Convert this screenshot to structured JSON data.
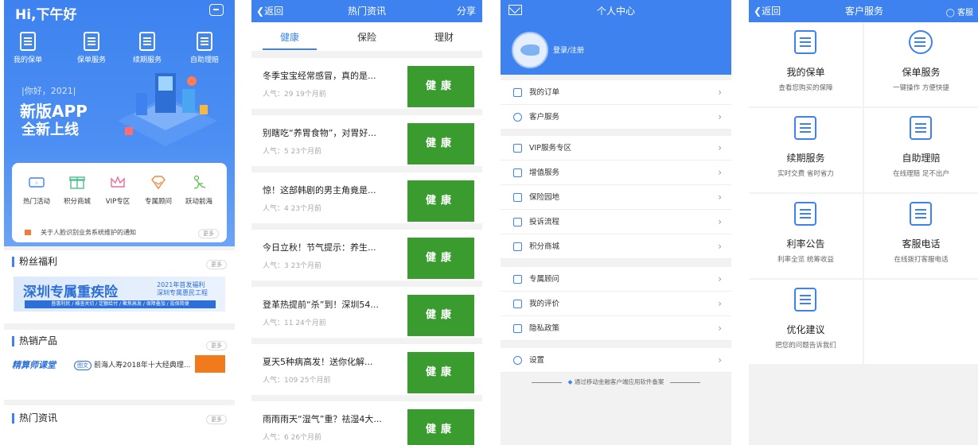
{
  "colors": {
    "brand_blue": "#3d82ef",
    "tag_green": "#3a9b2e",
    "accent_orange": "#f07a1c"
  },
  "phone1": {
    "greeting": "Hi,下午好",
    "quick_actions": [
      {
        "label": "我的保单",
        "icon": "policy-doc-icon"
      },
      {
        "label": "保单服务",
        "icon": "service-doc-icon"
      },
      {
        "label": "续期服务",
        "icon": "renewal-icon"
      },
      {
        "label": "自助理赔",
        "icon": "claim-icon"
      }
    ],
    "banner": {
      "year_line": "|你好，2021|",
      "line1": "新版APP",
      "line2": "全新上线"
    },
    "promos": [
      {
        "label": "热门活动",
        "icon": "ticket-icon"
      },
      {
        "label": "积分商城",
        "icon": "gift-icon"
      },
      {
        "label": "VIP专区",
        "icon": "crown-icon"
      },
      {
        "label": "专属顾问",
        "icon": "diamond-icon"
      },
      {
        "label": "跃动前海",
        "icon": "runner-icon"
      }
    ],
    "notice": "关于人脸识别业务系统维护的通知",
    "more": "更多",
    "fans": {
      "title": "粉丝福利",
      "banner_main": "深圳专属重疾险",
      "banner_side1": "2021年首发福利",
      "banner_side2": "深圳专属惠民工程",
      "banner_strip": "普惠利民 / 横竖关切 / 定额给付 / 聚焦高发 / 保障叠加 / 投保简便"
    },
    "hot_products": {
      "title": "热销产品",
      "course": "精算师课堂",
      "badge": "图文",
      "text": "前海人寿2018年十大经典理..."
    },
    "hot_news": {
      "title": "热门资讯"
    }
  },
  "phone2": {
    "back": "返回",
    "title": "热门资讯",
    "share": "分享",
    "tabs": [
      "健康",
      "保险",
      "理财"
    ],
    "articles": [
      {
        "title": "冬季宝宝经常感冒，真的是...",
        "meta": "人气：29    19个月前",
        "tag": "健康"
      },
      {
        "title": "别瞎吃“养胃食物”，对胃好...",
        "meta": "人气：5    23个月前",
        "tag": "健康"
      },
      {
        "title": "惊！这部韩剧的男主角竟是...",
        "meta": "人气：4    23个月前",
        "tag": "健康"
      },
      {
        "title": "今日立秋！节气提示：养生...",
        "meta": "人气：3    23个月前",
        "tag": "健康"
      },
      {
        "title": "登革热提前“杀”到！深圳54...",
        "meta": "人气：11    24个月前",
        "tag": "健康"
      },
      {
        "title": "夏天5种病高发！送你化解...",
        "meta": "人气：109    25个月前",
        "tag": "健康"
      },
      {
        "title": "雨雨雨天“湿气”重？祛湿4大...",
        "meta": "人气：6    26个月前",
        "tag": "健康"
      }
    ]
  },
  "phone3": {
    "title": "个人中心",
    "login": "登录/注册",
    "group1": [
      {
        "label": "我的订单",
        "icon": "order-icon"
      },
      {
        "label": "客户服务",
        "icon": "heart-icon"
      }
    ],
    "group2": [
      {
        "label": "VIP服务专区",
        "icon": "vip-icon"
      },
      {
        "label": "增值服务",
        "icon": "bars-icon"
      },
      {
        "label": "保险园地",
        "icon": "book-icon"
      },
      {
        "label": "投诉流程",
        "icon": "complaint-icon"
      },
      {
        "label": "积分商城",
        "icon": "store-icon"
      }
    ],
    "group3": [
      {
        "label": "专属顾问",
        "icon": "advisor-icon"
      },
      {
        "label": "我的评价",
        "icon": "star-icon"
      },
      {
        "label": "隐私政策",
        "icon": "mail-icon"
      }
    ],
    "group4": [
      {
        "label": "设置",
        "icon": "gear-icon"
      }
    ],
    "footer": "通过移动金融客户端应用软件备案"
  },
  "phone4": {
    "back": "返回",
    "title": "客户服务",
    "right": "客服",
    "services": [
      {
        "name": "我的保单",
        "desc": "查看您购买的保障",
        "icon": "policy-icon"
      },
      {
        "name": "保单服务",
        "desc": "一键操作 方便快捷",
        "icon": "yuan-circle-icon"
      },
      {
        "name": "续期服务",
        "desc": "实时交费 省时省力",
        "icon": "renewal-doc-icon"
      },
      {
        "name": "自助理赔",
        "desc": "在线理赔 足不出户",
        "icon": "star-doc-icon"
      },
      {
        "name": "利率公告",
        "desc": "利率全览 统筹收益",
        "icon": "rate-icon"
      },
      {
        "name": "客服电话",
        "desc": "在线拨打客服电话",
        "icon": "phone-list-icon"
      },
      {
        "name": "优化建议",
        "desc": "把您的问题告诉我们",
        "icon": "edit-icon"
      }
    ]
  }
}
